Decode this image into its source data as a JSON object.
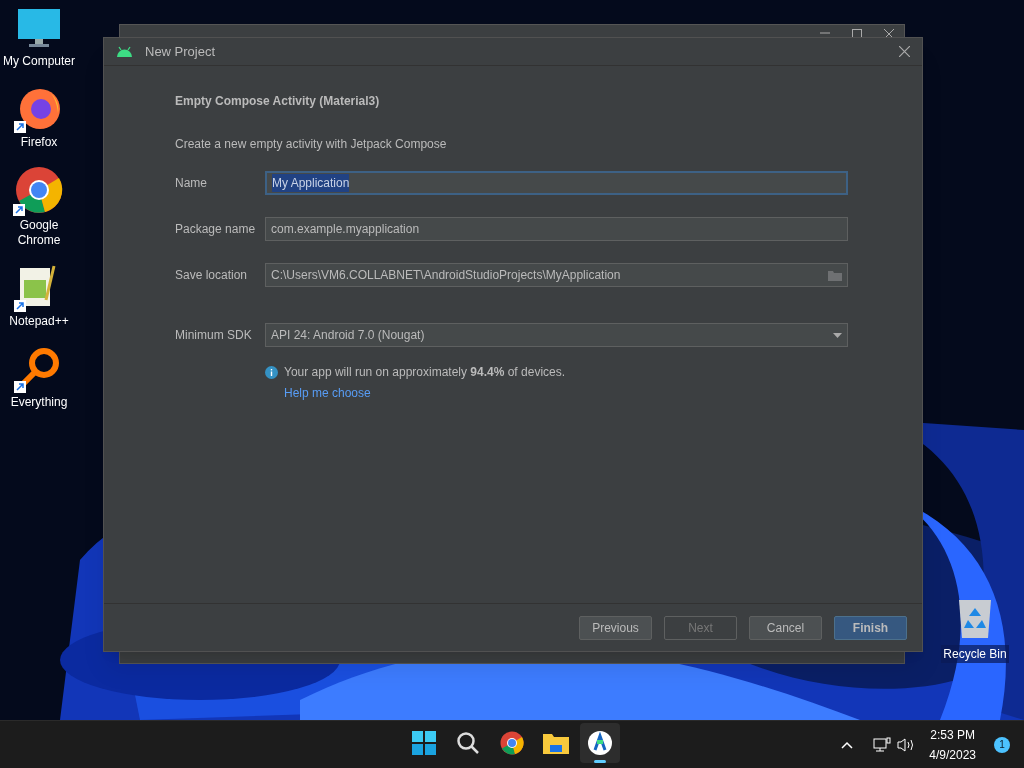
{
  "desktop_icons": [
    {
      "kind": "computer",
      "label": "My Computer",
      "shortcut": false
    },
    {
      "kind": "firefox",
      "label": "Firefox",
      "shortcut": true
    },
    {
      "kind": "chrome",
      "label": "Google Chrome",
      "shortcut": true
    },
    {
      "kind": "notepad",
      "label": "Notepad++",
      "shortcut": true
    },
    {
      "kind": "everything",
      "label": "Everything",
      "shortcut": true
    }
  ],
  "recycle_bin": {
    "label": "Recycle Bin"
  },
  "dialog": {
    "title": "New Project",
    "heading": "Empty Compose Activity (Material3)",
    "description": "Create a new empty activity with Jetpack Compose",
    "fields": [
      {
        "kind": "text",
        "label": "Name",
        "value": "My Application",
        "focused": true
      },
      {
        "kind": "text",
        "label": "Package name",
        "value": "com.example.myapplication",
        "focused": false
      },
      {
        "kind": "path",
        "label": "Save location",
        "value": "C:\\Users\\VM6.COLLABNET\\AndroidStudioProjects\\MyApplication",
        "focused": false
      },
      {
        "kind": "dropdown",
        "label": "Minimum SDK",
        "value": "API 24: Android 7.0 (Nougat)",
        "focused": false
      }
    ],
    "info": "Your app will run on approximately **94.4%** of devices.",
    "link": "Help me choose",
    "buttons": [
      {
        "label": "Previous",
        "disabled": false,
        "default": false
      },
      {
        "label": "Next",
        "disabled": true,
        "default": false
      },
      {
        "label": "Cancel",
        "disabled": false,
        "default": false
      },
      {
        "label": "Finish",
        "disabled": false,
        "default": true
      }
    ]
  },
  "taskbar": {
    "apps": [
      {
        "kind": "start",
        "selected": false
      },
      {
        "kind": "search",
        "selected": false
      },
      {
        "kind": "chrome",
        "selected": false
      },
      {
        "kind": "folder",
        "selected": false
      },
      {
        "kind": "studio",
        "selected": true
      }
    ],
    "time": "2:53 PM",
    "date": "4/9/2023",
    "notifications": "1"
  }
}
